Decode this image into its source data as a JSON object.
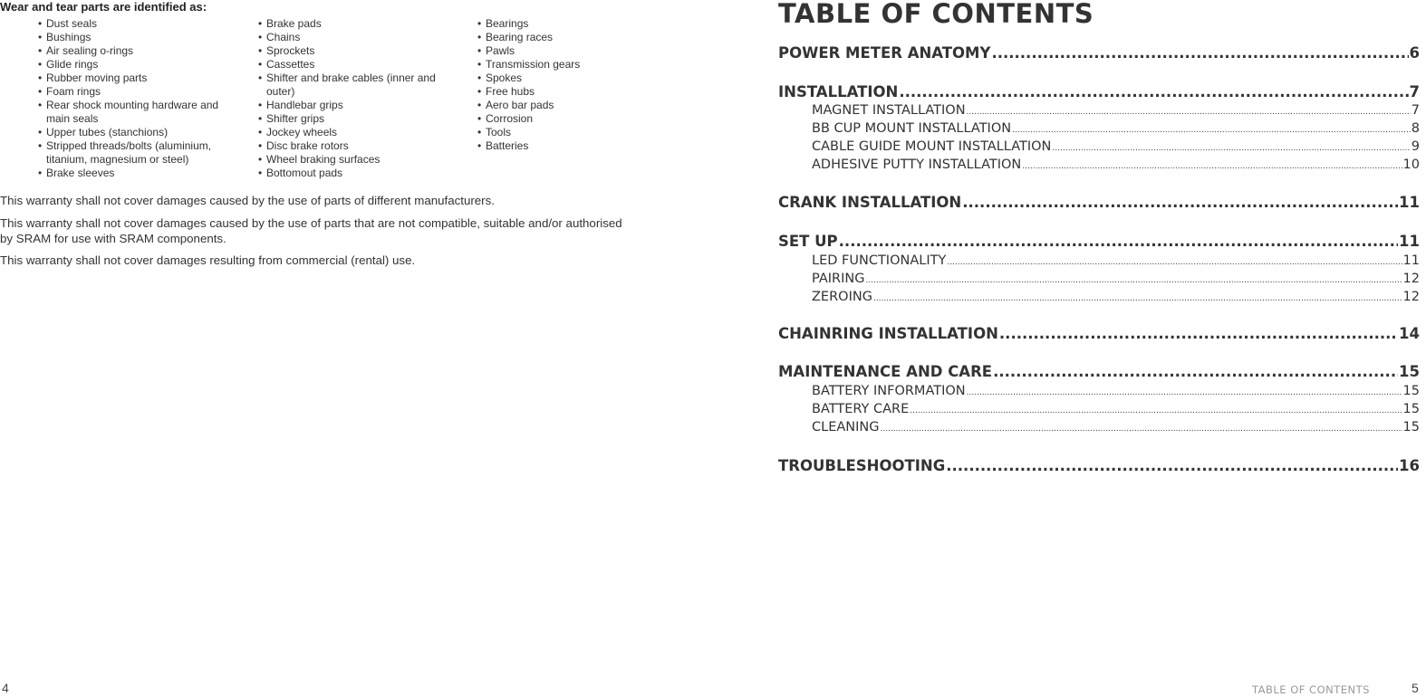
{
  "left": {
    "heading": "Wear and tear parts are identified as:",
    "columns": [
      [
        "Dust seals",
        "Bushings",
        "Air sealing o-rings",
        "Glide rings",
        "Rubber moving parts",
        "Foam rings",
        "Rear shock mounting hardware and main seals",
        "Upper tubes (stanchions)",
        "Stripped threads/bolts (aluminium, titanium, magnesium or steel)",
        "Brake sleeves"
      ],
      [
        "Brake pads",
        "Chains",
        "Sprockets",
        "Cassettes",
        "Shifter and brake cables (inner and outer)",
        "Handlebar grips",
        "Shifter grips",
        "Jockey wheels",
        "Disc brake rotors",
        "Wheel braking surfaces",
        "Bottomout pads"
      ],
      [
        "Bearings",
        "Bearing races",
        "Pawls",
        "Transmission gears",
        "Spokes",
        "Free hubs",
        "Aero bar pads",
        "Corrosion",
        "Tools",
        "Batteries"
      ]
    ],
    "paragraphs": [
      "This warranty shall not cover damages caused by the use of parts of different manufacturers.",
      "This warranty shall not cover damages caused by the use of parts that are not compatible, suitable and/or authorised by SRAM for use with SRAM components.",
      "This warranty shall not cover damages resulting from commercial (rental) use."
    ],
    "page_number": "4"
  },
  "toc": {
    "title": "TABLE OF CONTENTS",
    "entries": [
      {
        "label": "POWER METER ANATOMY",
        "page": "6",
        "level": "major"
      },
      {
        "label": "INSTALLATION",
        "page": "7",
        "level": "major"
      },
      {
        "label": "MAGNET INSTALLATION",
        "page": "7",
        "level": "sub"
      },
      {
        "label": "BB CUP MOUNT INSTALLATION",
        "page": "8",
        "level": "sub"
      },
      {
        "label": "CABLE GUIDE MOUNT INSTALLATION",
        "page": "9",
        "level": "sub"
      },
      {
        "label": "ADHESIVE PUTTY INSTALLATION",
        "page": "10",
        "level": "sub"
      },
      {
        "label": "CRANK INSTALLATION",
        "page": "11",
        "level": "major"
      },
      {
        "label": "SET UP",
        "page": "11",
        "level": "major"
      },
      {
        "label": "LED FUNCTIONALITY",
        "page": "11",
        "level": "sub"
      },
      {
        "label": "PAIRING",
        "page": "12",
        "level": "sub"
      },
      {
        "label": "ZEROING",
        "page": "12",
        "level": "sub"
      },
      {
        "label": "CHAINRING INSTALLATION",
        "page": "14",
        "level": "major"
      },
      {
        "label": "MAINTENANCE AND CARE",
        "page": "15",
        "level": "major"
      },
      {
        "label": "BATTERY INFORMATION",
        "page": "15",
        "level": "sub"
      },
      {
        "label": "BATTERY CARE",
        "page": "15",
        "level": "sub"
      },
      {
        "label": "CLEANING",
        "page": "15",
        "level": "sub"
      },
      {
        "label": "TROUBLESHOOTING",
        "page": "16",
        "level": "major"
      }
    ],
    "footer_label": "TABLE OF CONTENTS",
    "page_number": "5"
  }
}
